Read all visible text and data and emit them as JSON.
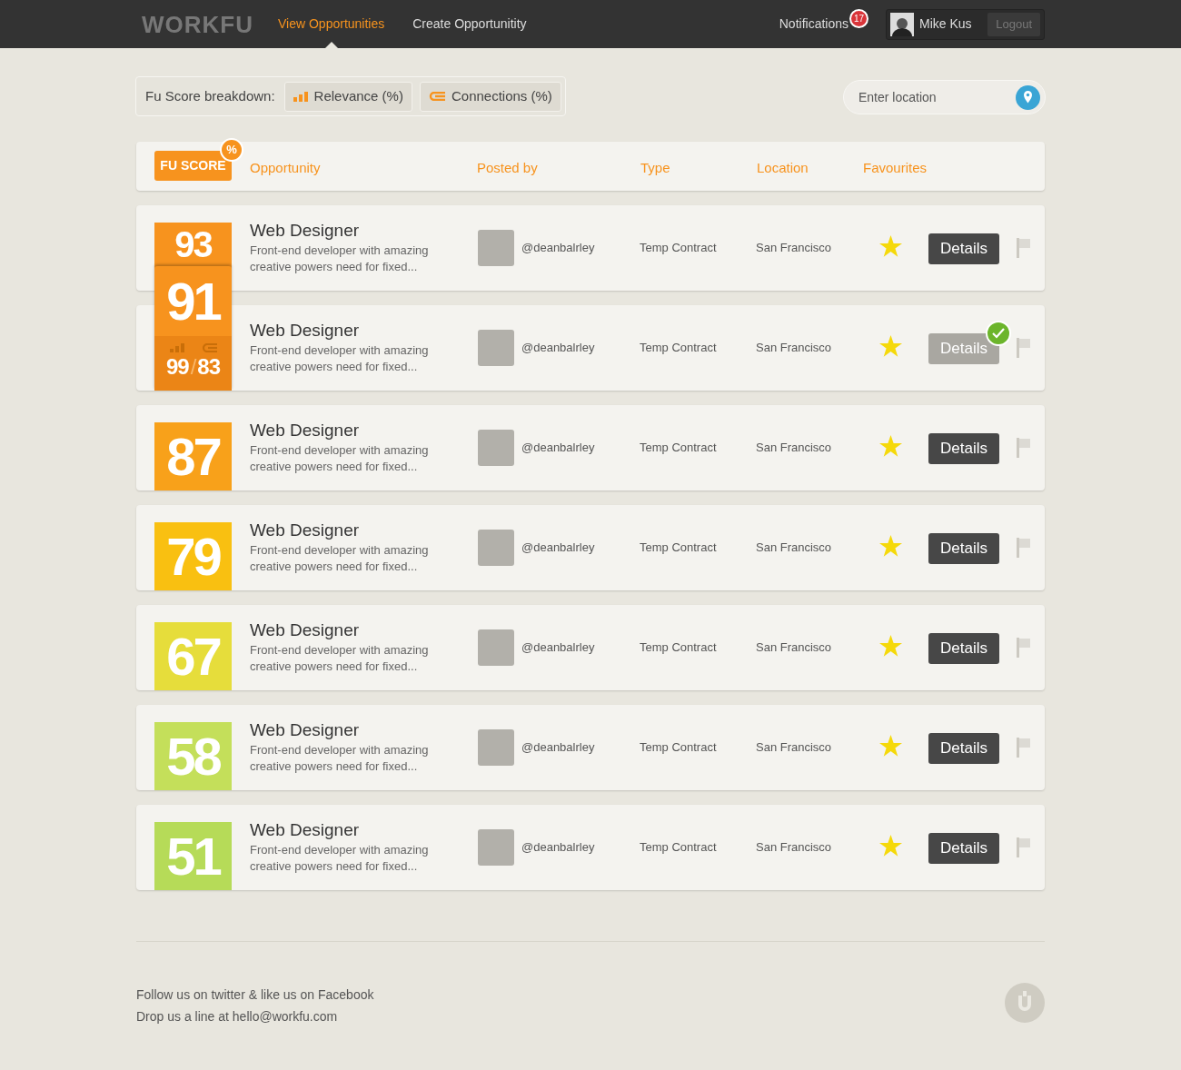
{
  "nav": {
    "logo": "WORKFU",
    "items": [
      {
        "label": "View Opportunities",
        "selected": true
      },
      {
        "label": "Create Opportunitity",
        "selected": false
      }
    ],
    "notifications": {
      "label": "Notifications",
      "count": "17"
    },
    "user": {
      "name": "Mike Kus",
      "logout": "Logout"
    }
  },
  "filter": {
    "label": "Fu Score breakdown:",
    "buttons": [
      {
        "kind": "relevance",
        "label": "Relevance (%)"
      },
      {
        "kind": "connections",
        "label": "Connections (%)"
      }
    ],
    "location": {
      "placeholder": "Enter location"
    }
  },
  "table": {
    "score_badge": "FU SCORE",
    "score_badge_mark": "%",
    "columns": [
      "Opportunity",
      "Posted by",
      "Type",
      "Location",
      "Favourites"
    ],
    "rows": [
      {
        "score": "93",
        "color": "#f7931e",
        "title": "Web Designer",
        "description": "Front-end developer with amazing creative powers need for fixed...",
        "poster": "@deanbalrley",
        "type": "Temp Contract",
        "location": "San Francisco",
        "details": "Details",
        "applied": false
      },
      {
        "score": "91",
        "color": "#f7931e",
        "title": "Web Designer",
        "description": "Front-end developer with amazing creative powers need for fixed...",
        "poster": "@deanbalrley",
        "type": "Temp Contract",
        "location": "San Francisco",
        "details": "Details",
        "applied": true,
        "breakdown": {
          "relevance": "99",
          "separator": "/",
          "connections": "83"
        }
      },
      {
        "score": "87",
        "color": "#f8a11a",
        "title": "Web Designer",
        "description": "Front-end developer with amazing creative powers need for fixed...",
        "poster": "@deanbalrley",
        "type": "Temp Contract",
        "location": "San Francisco",
        "details": "Details",
        "applied": false
      },
      {
        "score": "79",
        "color": "#f9c011",
        "title": "Web Designer",
        "description": "Front-end developer with amazing creative powers need for fixed...",
        "poster": "@deanbalrley",
        "type": "Temp Contract",
        "location": "San Francisco",
        "details": "Details",
        "applied": false
      },
      {
        "score": "67",
        "color": "#e6dd3b",
        "title": "Web Designer",
        "description": "Front-end developer with amazing creative powers need for fixed...",
        "poster": "@deanbalrley",
        "type": "Temp Contract",
        "location": "San Francisco",
        "details": "Details",
        "applied": false
      },
      {
        "score": "58",
        "color": "#c4df5a",
        "title": "Web Designer",
        "description": "Front-end developer with amazing creative powers need for fixed...",
        "poster": "@deanbalrley",
        "type": "Temp Contract",
        "location": "San Francisco",
        "details": "Details",
        "applied": false
      },
      {
        "score": "51",
        "color": "#b6db58",
        "title": "Web Designer",
        "description": "Front-end developer with amazing creative powers need for fixed...",
        "poster": "@deanbalrley",
        "type": "Temp Contract",
        "location": "San Francisco",
        "details": "Details",
        "applied": false
      }
    ]
  },
  "footer": {
    "lines": [
      "Follow us on twitter & like us on Facebook",
      "Drop us a line at hello@workfu.com"
    ]
  }
}
